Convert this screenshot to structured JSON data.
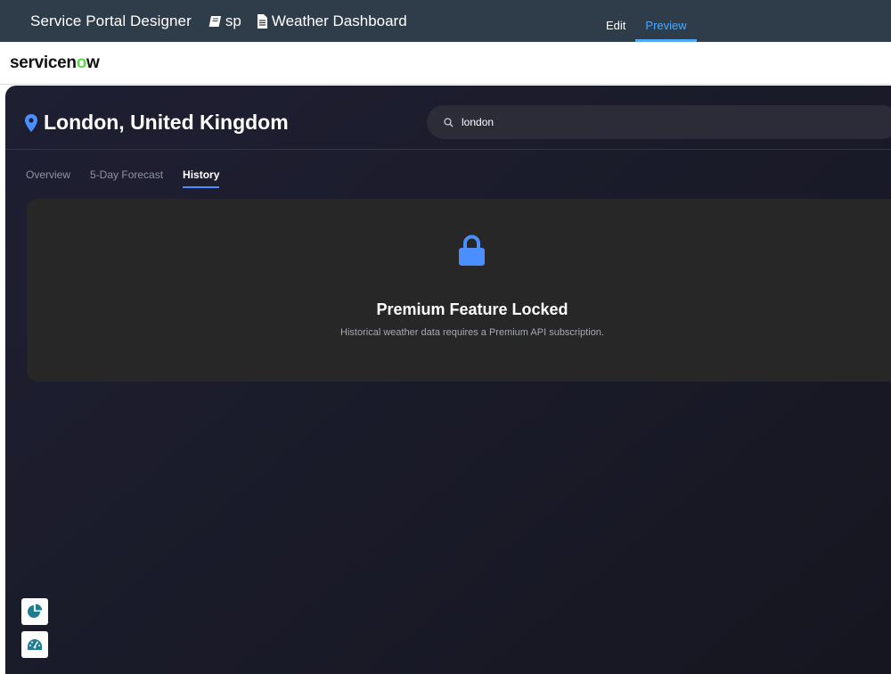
{
  "topbar": {
    "title": "Service Portal Designer",
    "portal_name": "sp",
    "page_name": "Weather Dashboard",
    "tabs": [
      {
        "label": "Edit",
        "active": false
      },
      {
        "label": "Preview",
        "active": true
      }
    ]
  },
  "header": {
    "logo_text_before": "servicen",
    "logo_text_o": "o",
    "logo_text_after": "w"
  },
  "dashboard": {
    "location": "London, United Kingdom",
    "search": {
      "value": "london"
    },
    "tabs": [
      {
        "label": "Overview",
        "active": false
      },
      {
        "label": "5-Day Forecast",
        "active": false
      },
      {
        "label": "History",
        "active": true
      }
    ],
    "locked": {
      "title": "Premium Feature Locked",
      "description": "Historical weather data requires a Premium API subscription."
    }
  },
  "floating_buttons": [
    {
      "icon": "pie-chart-icon"
    },
    {
      "icon": "gauge-icon"
    }
  ],
  "colors": {
    "accent_blue": "#4a8eff",
    "topbar_bg": "#2e3d49",
    "logo_green": "#62d84e",
    "card_bg": "#272727"
  }
}
